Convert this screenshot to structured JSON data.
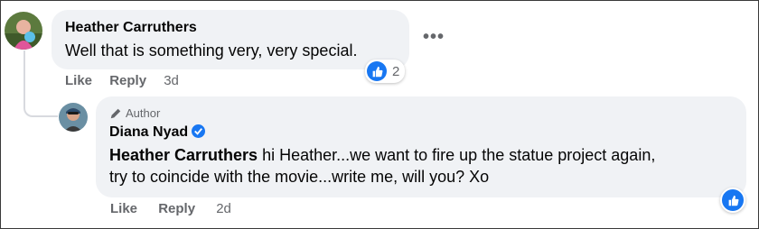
{
  "comment": {
    "author": "Heather Carruthers",
    "text": "Well that is something very, very special.",
    "reaction_count": "2",
    "actions": {
      "like": "Like",
      "reply": "Reply",
      "time": "3d"
    }
  },
  "reply": {
    "badge": "Author",
    "author": "Diana Nyad",
    "mention": "Heather Carruthers",
    "text_line1": " hi Heather...we want to fire up the statue project again,",
    "text_line2": "try to coincide with the movie...write me, will you? Xo",
    "actions": {
      "like": "Like",
      "reply": "Reply",
      "time": "2d"
    }
  },
  "icons": {
    "more": "more-options-icon",
    "like_reaction": "like-reaction-icon",
    "pencil": "pencil-icon",
    "verified": "verified-badge-icon"
  },
  "colors": {
    "bubble": "#f0f2f5",
    "like_blue": "#1877f2",
    "meta_gray": "#65676b"
  }
}
